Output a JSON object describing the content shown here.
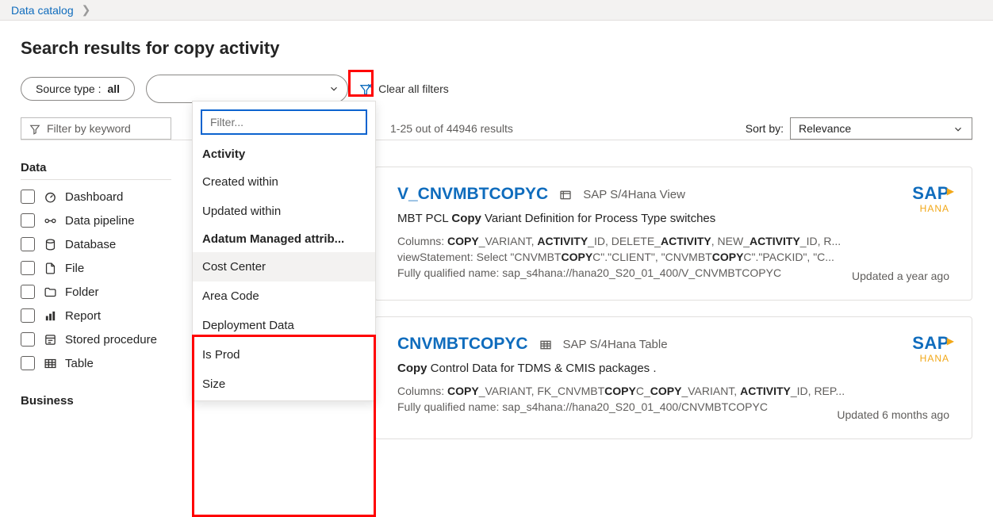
{
  "breadcrumb": {
    "root": "Data catalog"
  },
  "page_title": "Search results for copy activity",
  "pills": {
    "source_type_label": "Source type :",
    "source_type_value": "all",
    "clear_filters_label": "Clear all filters"
  },
  "dropdown": {
    "filter_placeholder": "Filter...",
    "group1_title": "Activity",
    "group1_items": [
      "Created within",
      "Updated within"
    ],
    "group2_title": "Adatum Managed attrib...",
    "group2_items": [
      "Cost Center",
      "Area Code",
      "Deployment Data",
      "Is Prod",
      "Size"
    ]
  },
  "under_row": {
    "filter_keyword_placeholder": "Filter by keyword",
    "results_count_text": "1-25 out of 44946 results",
    "sort_label": "Sort by:",
    "sort_value": "Relevance"
  },
  "facets": {
    "group_data_title": "Data",
    "data_items": [
      {
        "label": "Dashboard",
        "icon": "dashboard"
      },
      {
        "label": "Data pipeline",
        "icon": "pipeline"
      },
      {
        "label": "Database",
        "icon": "database"
      },
      {
        "label": "File",
        "icon": "file"
      },
      {
        "label": "Folder",
        "icon": "folder"
      },
      {
        "label": "Report",
        "icon": "report"
      },
      {
        "label": "Stored procedure",
        "icon": "sproc"
      },
      {
        "label": "Table",
        "icon": "table"
      }
    ],
    "group_business_title": "Business"
  },
  "sap_badge": {
    "brand": "SAP",
    "sub": "HANA"
  },
  "results": [
    {
      "title": "V_CNVMBTCOPYC",
      "type_label": "SAP S/4Hana View",
      "description_prefix": "MBT PCL ",
      "description_bold": "Copy",
      "description_suffix": " Variant Definition for Process Type switches",
      "meta1_html": "Columns: <b>COPY</b>_VARIANT, <b>ACTIVITY</b>_ID, DELETE_<b>ACTIVITY</b>, NEW_<b>ACTIVITY</b>_ID, R...",
      "meta2_html": "viewStatement: Select \"CNVMBT<b>COPY</b>C\".\"CLIENT\", \"CNVMBT<b>COPY</b>C\".\"PACKID\", \"C...",
      "meta3_html": "Fully qualified name: sap_s4hana://hana20_S20_01_400/V_CNVMBTCOPYC",
      "updated": "Updated a year ago"
    },
    {
      "title": "CNVMBTCOPYC",
      "type_label": "SAP S/4Hana Table",
      "description_prefix": "",
      "description_bold": "Copy",
      "description_suffix": " Control Data for TDMS & CMIS packages .",
      "meta1_html": "Columns: <b>COPY</b>_VARIANT, FK_CNVMBT<b>COPY</b>C_<b>COPY</b>_VARIANT, <b>ACTIVITY</b>_ID, REP...",
      "meta2_html": "Fully qualified name: sap_s4hana://hana20_S20_01_400/CNVMBTCOPYC",
      "meta3_html": "",
      "updated": "Updated 6 months ago"
    }
  ]
}
